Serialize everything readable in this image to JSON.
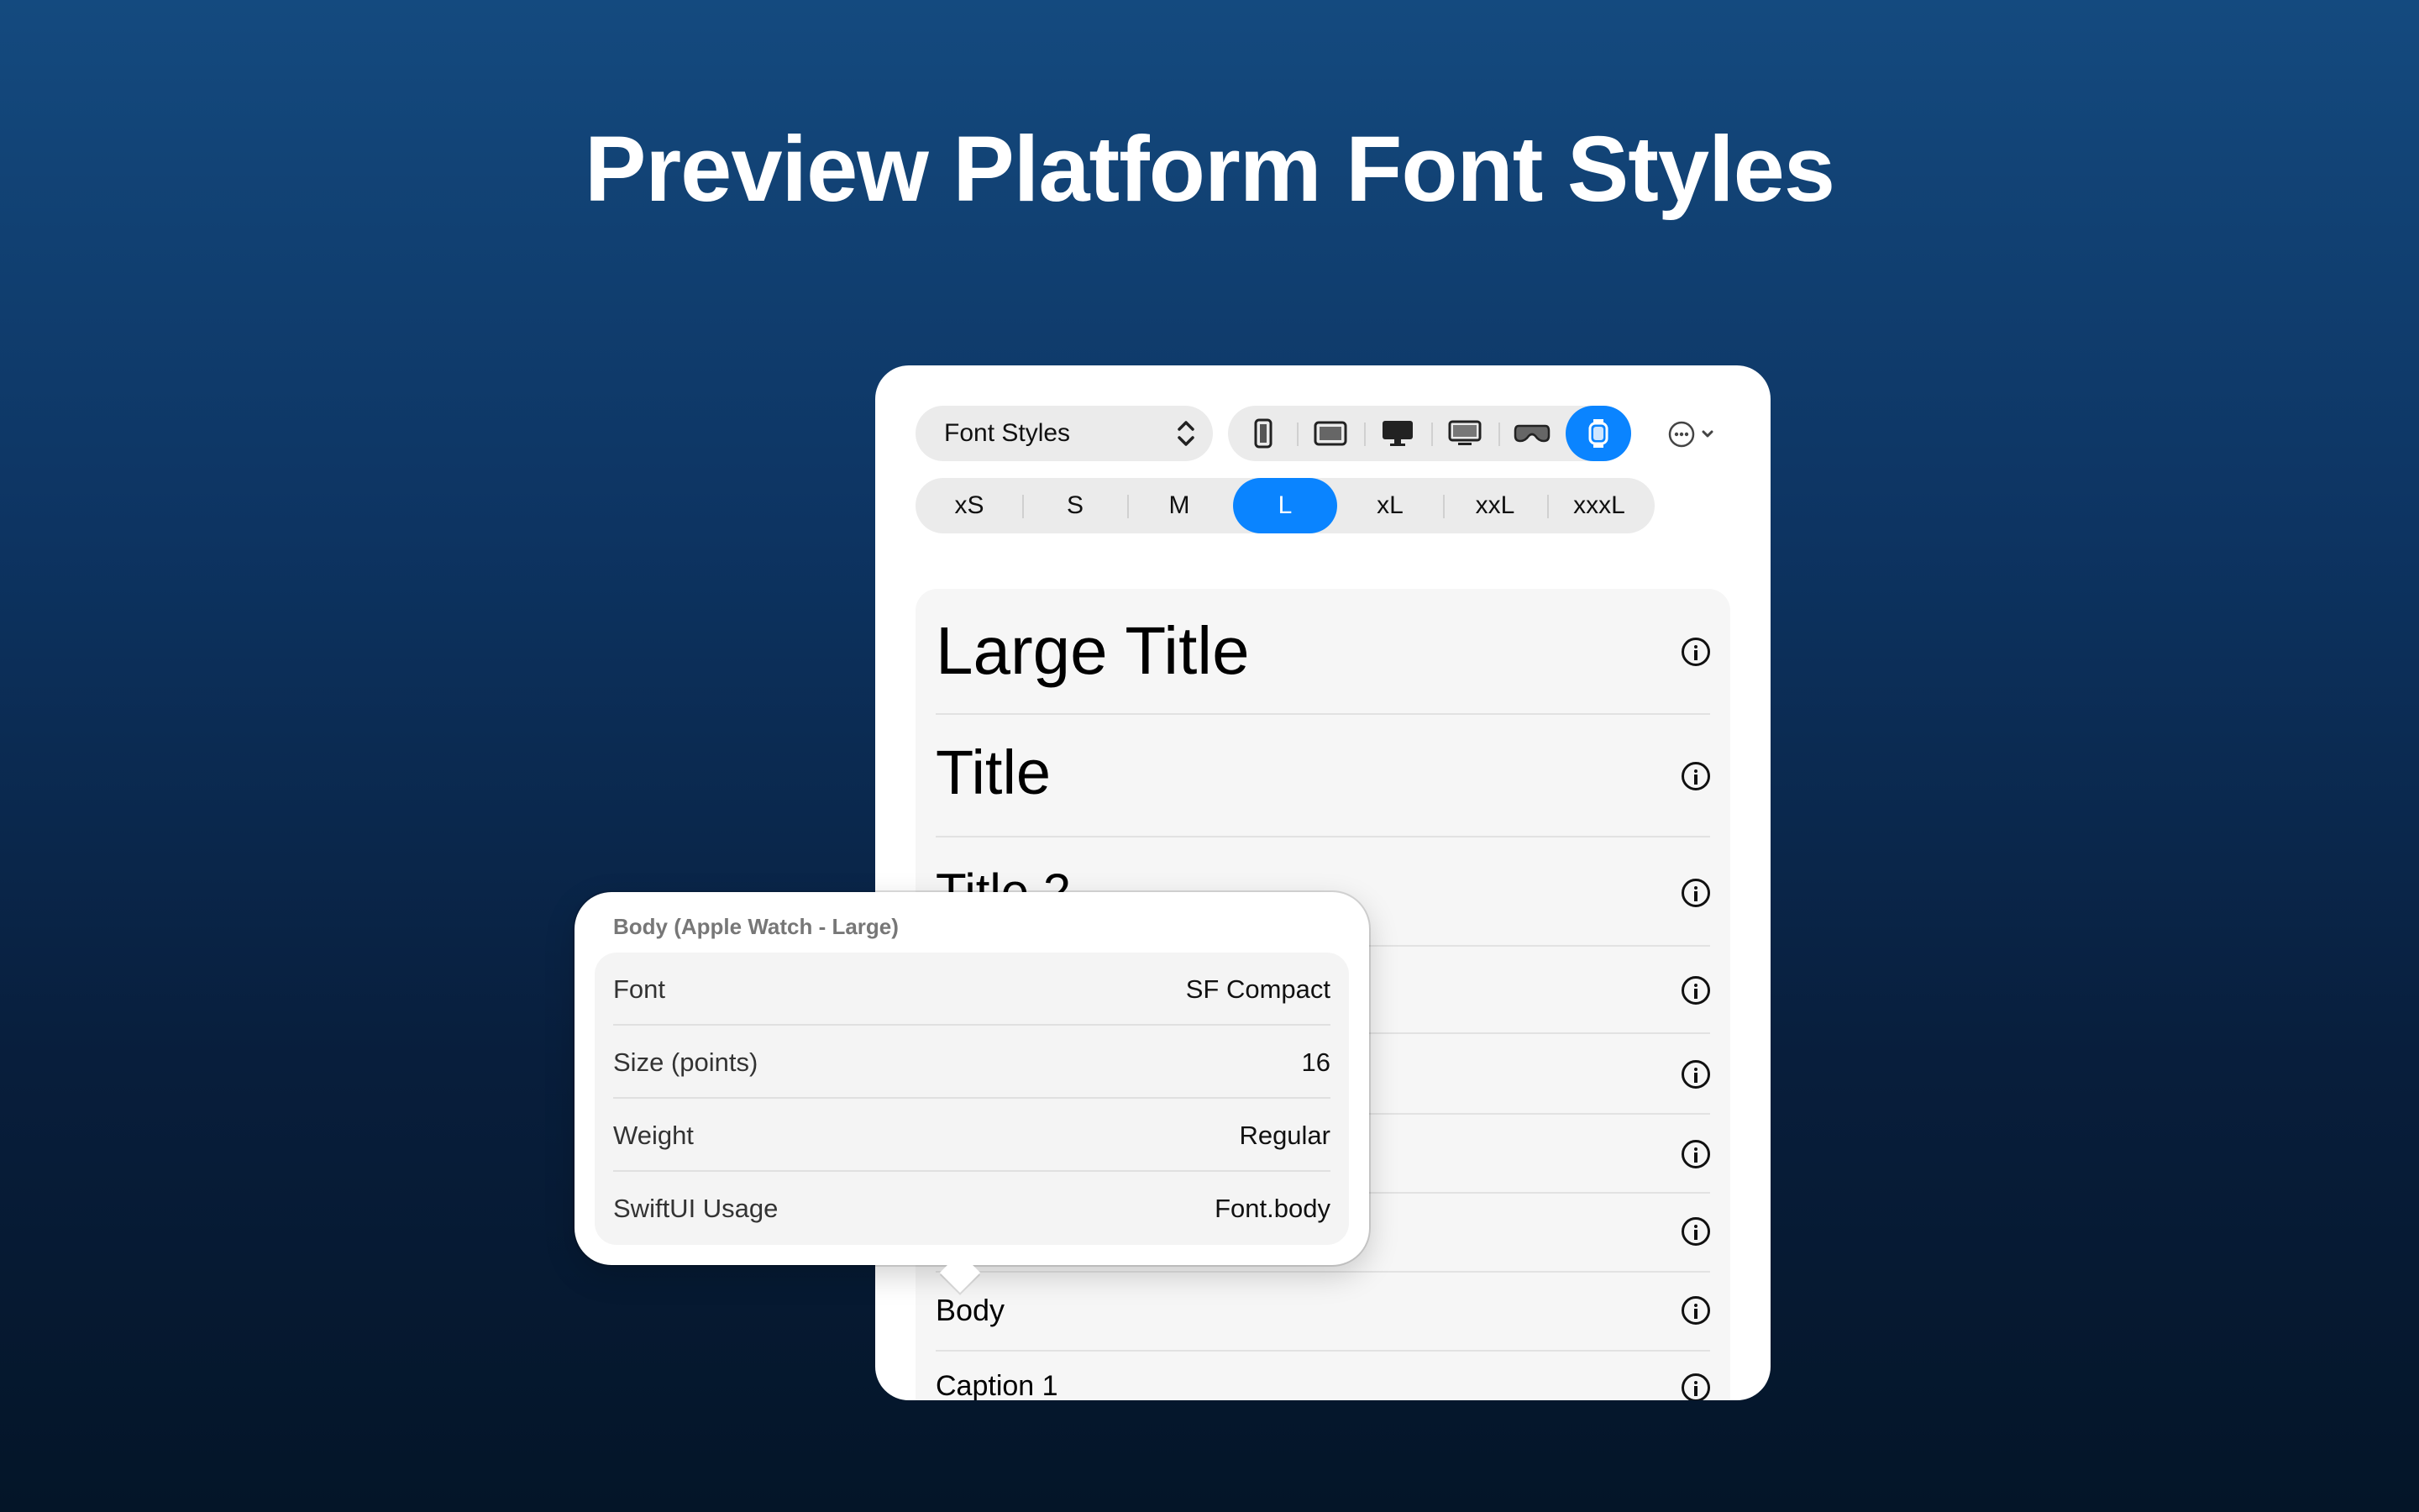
{
  "headline": "Preview Platform Font Styles",
  "toolbar": {
    "picker_label": "Font Styles",
    "devices": [
      {
        "name": "iphone-icon"
      },
      {
        "name": "ipad-icon"
      },
      {
        "name": "imac-icon"
      },
      {
        "name": "tv-icon"
      },
      {
        "name": "vision-pro-icon"
      },
      {
        "name": "apple-watch-icon",
        "selected": true
      }
    ],
    "more_icon": "ellipsis-circle-icon"
  },
  "sizes": [
    "xS",
    "S",
    "M",
    "L",
    "xL",
    "xxL",
    "xxxL"
  ],
  "selected_size": "L",
  "list": {
    "items": [
      {
        "label": "Large Title"
      },
      {
        "label": "Title"
      },
      {
        "label": "Title 2"
      },
      {
        "label": ""
      },
      {
        "label": ""
      },
      {
        "label": ""
      },
      {
        "label": ""
      },
      {
        "label": "Body"
      },
      {
        "label": "Caption 1"
      }
    ]
  },
  "popover": {
    "title": "Body (Apple Watch - Large)",
    "rows": [
      {
        "key": "Font",
        "value": "SF Compact"
      },
      {
        "key": "Size (points)",
        "value": "16"
      },
      {
        "key": "Weight",
        "value": "Regular"
      },
      {
        "key": "SwiftUI Usage",
        "value": "Font.body"
      }
    ]
  },
  "colors": {
    "accent": "#0a84ff",
    "background_top": "#144a7f",
    "background_bottom": "#041528"
  }
}
